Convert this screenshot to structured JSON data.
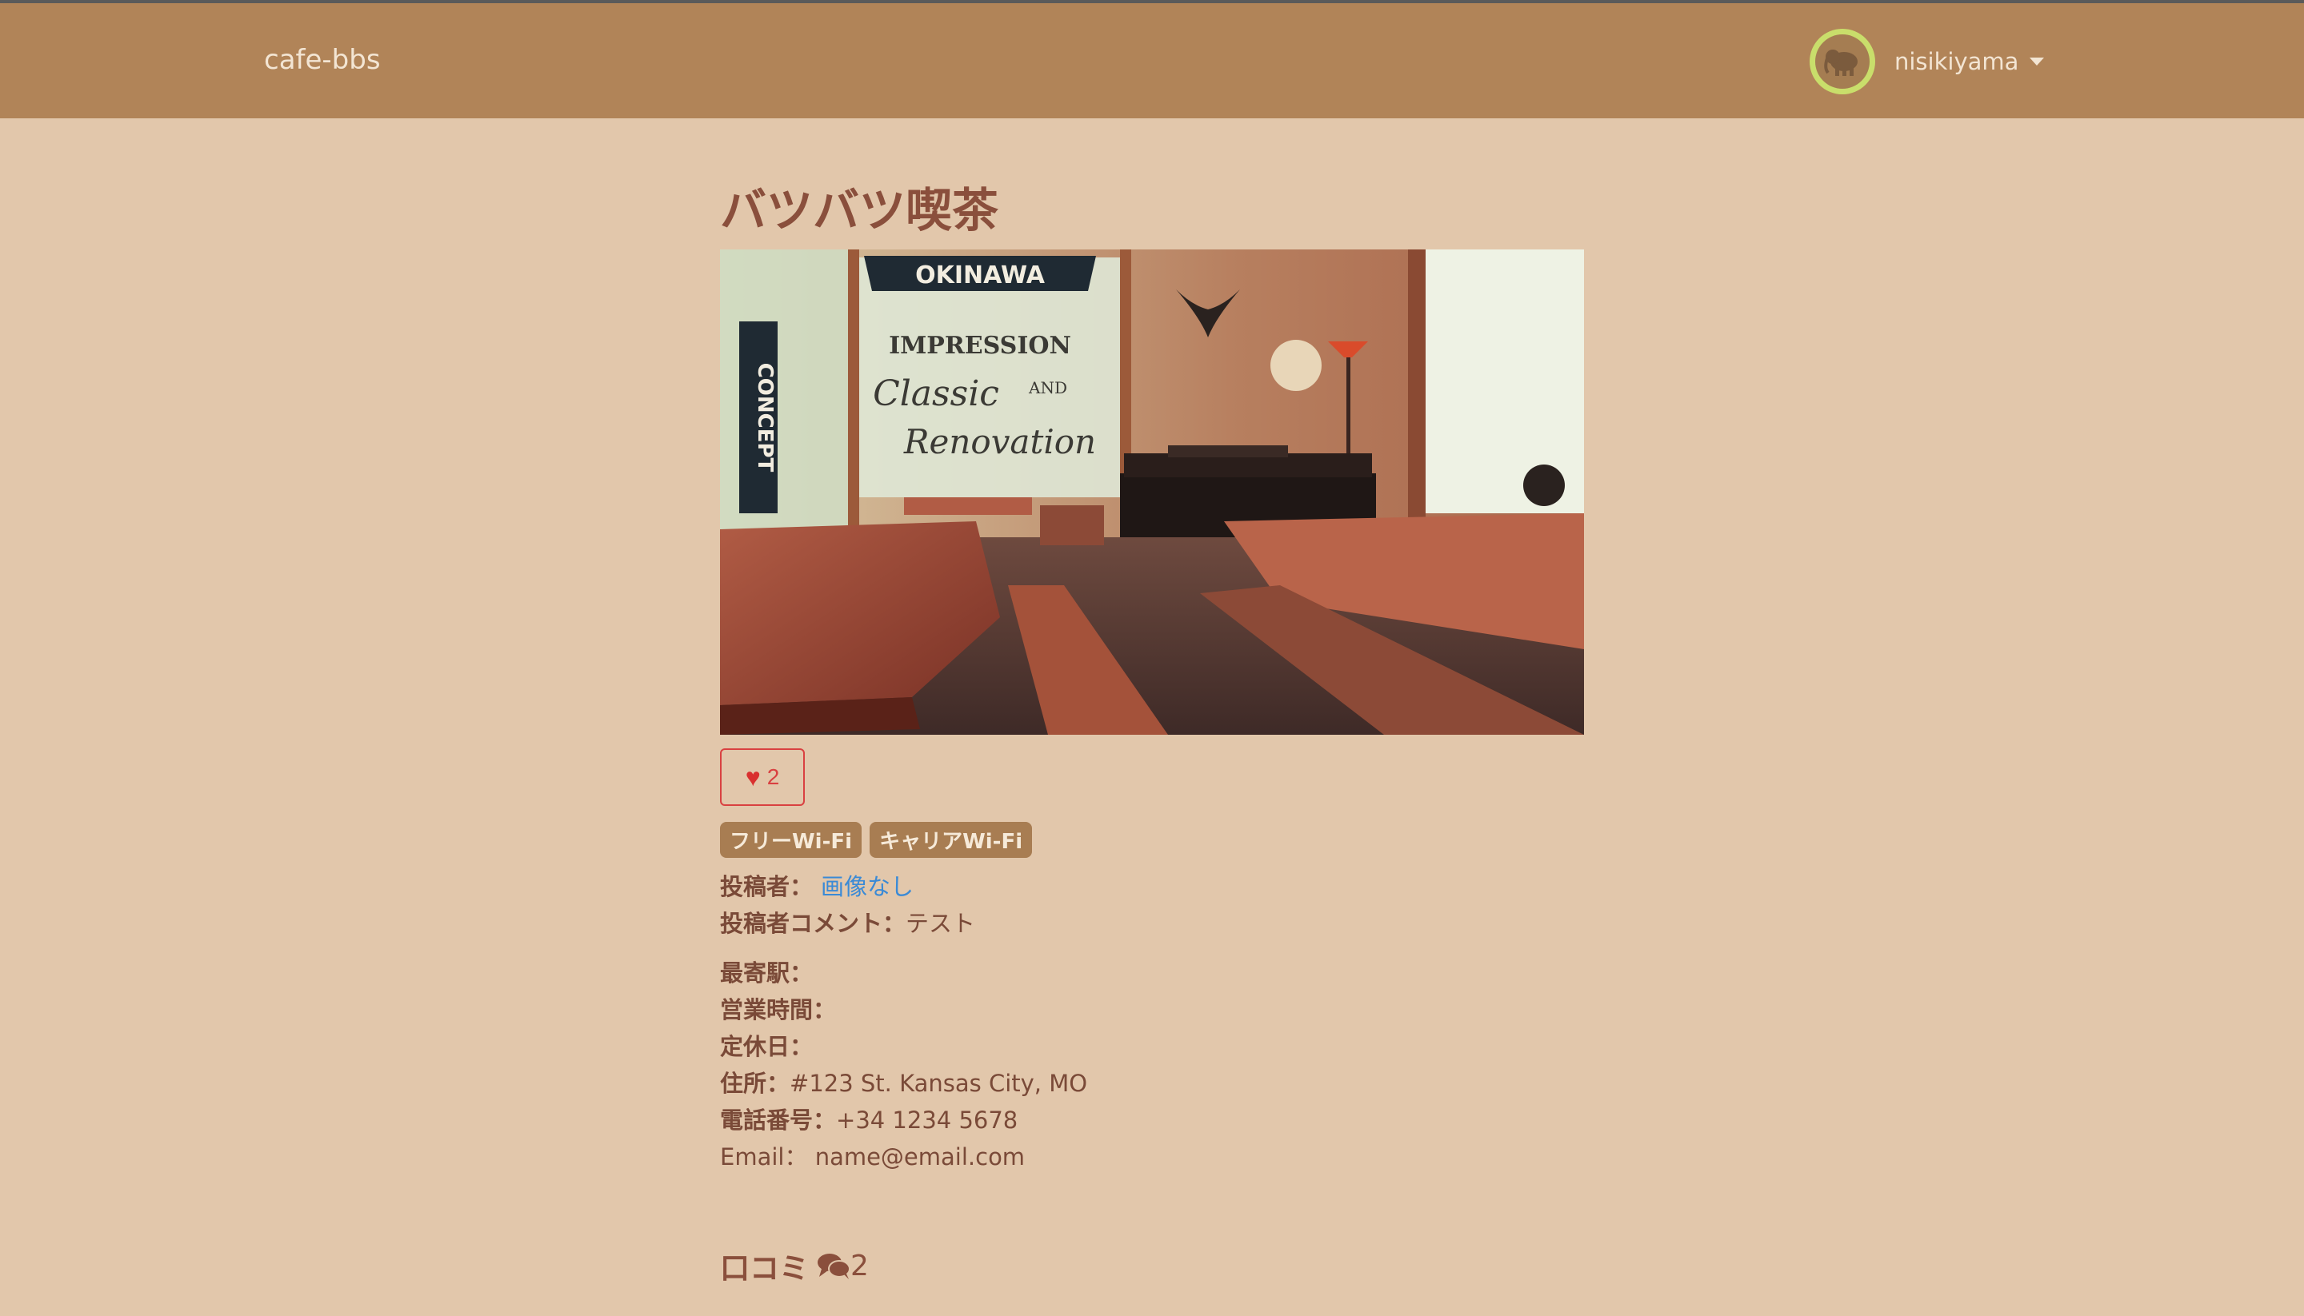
{
  "navbar": {
    "brand": "cafe-bbs",
    "username": "nisikiyama"
  },
  "cafe": {
    "name": "バツバツ喫茶",
    "photo_text": {
      "sign_top": "OKINAWA",
      "sign_side": "CONCEPT",
      "window_line1": "IMPRESSION",
      "window_line2": "Classic",
      "window_line3": "AND",
      "window_line4": "Renovation"
    },
    "like_count": "2",
    "tags": [
      "フリーWi-Fi",
      "キャリアWi-Fi"
    ],
    "poster_label": "投稿者：",
    "poster_name": "画像なし",
    "comment_label": "投稿者コメント：",
    "comment_value": "テスト",
    "station_label": "最寄駅：",
    "hours_label": "営業時間：",
    "holiday_label": "定休日：",
    "address_label": "住所：",
    "address_value": "#123 St. Kansas City, MO",
    "phone_label": "電話番号：",
    "phone_value": "+34 1234 5678",
    "email_label": "Email：",
    "email_value": "name@email.com"
  },
  "reviews": {
    "label": "口コミ",
    "count": "2"
  },
  "colors": {
    "background": "#e2c7ab",
    "navbar": "#b18458",
    "title": "#8a4f3c",
    "like": "#d94141",
    "tag": "#a87d52",
    "link": "#3a8ad6"
  }
}
